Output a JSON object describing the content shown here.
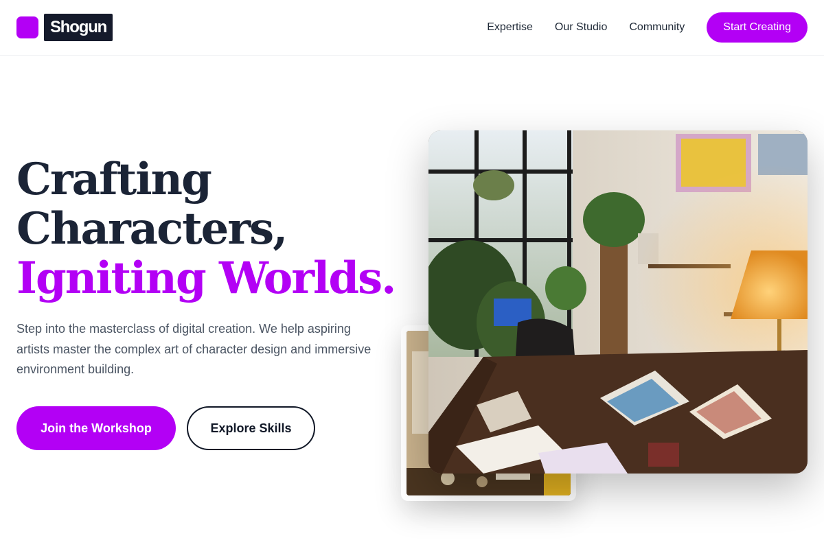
{
  "brand": {
    "name": "Shogun",
    "mark_color": "#b300f5"
  },
  "nav": {
    "items": [
      {
        "label": "Expertise"
      },
      {
        "label": "Our Studio"
      },
      {
        "label": "Community"
      }
    ],
    "cta_label": "Start Creating"
  },
  "hero": {
    "title_line1": "Crafting",
    "title_line2": "Characters,",
    "title_line3": "Igniting Worlds.",
    "description": "Step into the masterclass of digital creation. We help aspiring artists master the complex art of character design and immersive environment building.",
    "primary_button": "Join the Workshop",
    "secondary_button": "Explore Skills"
  },
  "images": {
    "main_photo_icon": "artist-studio-photo",
    "secondary_photo_icon": "studio-detail-photo"
  },
  "colors": {
    "accent": "#b300f5",
    "heading": "#1b2436",
    "body_text": "#4b5563"
  }
}
